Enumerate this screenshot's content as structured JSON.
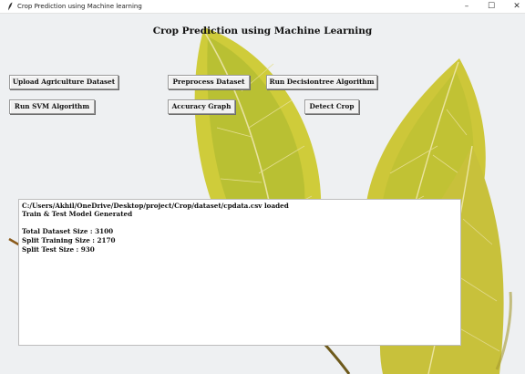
{
  "window": {
    "title": "Crop  Prediction using Machine learning",
    "controls": {
      "minimize": "–",
      "maximize": "☐",
      "close": "✕"
    }
  },
  "app": {
    "heading": "Crop  Prediction using Machine Learning"
  },
  "buttons": {
    "upload": "Upload Agriculture Dataset",
    "preprocess": "Preprocess Dataset",
    "decisiontree": "Run Decisiontree Algorithm",
    "svm": "Run SVM Algorithm",
    "accuracy": "Accuracy Graph",
    "detect": "Detect Crop"
  },
  "output": {
    "lines": [
      "C:/Users/Akhil/OneDrive/Desktop/project/Crop/dataset/cpdata.csv loaded",
      "Train & Test Model Generated",
      "",
      "Total Dataset Size : 3100",
      "Split Training Size : 2170",
      "Split Test Size : 930"
    ]
  },
  "colors": {
    "window_bg": "#eef0f2",
    "leaf_yellow": "#d8cf3a",
    "leaf_green": "#98ad2c",
    "stem": "#7b5d1c"
  },
  "icons": {
    "app": "feather-icon",
    "background": "yellow-leaves-image"
  }
}
